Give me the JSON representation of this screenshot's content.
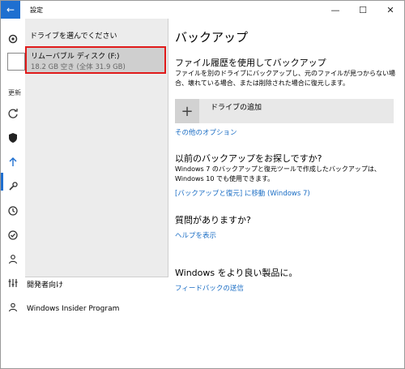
{
  "window": {
    "title": "設定",
    "back_glyph": "←",
    "minimize_glyph": "—",
    "maximize_glyph": "☐",
    "close_glyph": "✕"
  },
  "rail": {
    "update_label": "更新"
  },
  "drive_picker": {
    "header": "ドライブを選んでください",
    "items": [
      {
        "name": "リムーバブル ディスク (F:)",
        "size": "18.2 GB 空き (全体 31.9 GB)"
      }
    ]
  },
  "nav": {
    "items": [
      {
        "label": "開発者向け",
        "icon": "developer-icon"
      },
      {
        "label": "Windows Insider Program",
        "icon": "insider-icon"
      }
    ]
  },
  "main": {
    "title": "バックアップ",
    "file_history": {
      "title": "ファイル履歴を使用してバックアップ",
      "description": "ファイルを別のドライブにバックアップし、元のファイルが見つからない場合、壊れている場合、または削除された場合に復元します。",
      "add_drive_label": "ドライブの追加",
      "other_options_link": "その他のオプション"
    },
    "older_backup": {
      "title": "以前のバックアップをお探しですか?",
      "description": "Windows 7 のバックアップと復元ツールで作成したバックアップは、Windows 10 でも使用できます。",
      "link": "[バックアップと復元] に移動 (Windows 7)"
    },
    "question": {
      "title": "質問がありますか?",
      "link": "ヘルプを表示"
    },
    "feedback": {
      "title": "Windows をより良い製品に。",
      "link": "フィードバックの送信"
    }
  },
  "colors": {
    "accent": "#1e6fd0",
    "link": "#1a6dc4",
    "highlight_border": "#e01a1a"
  }
}
